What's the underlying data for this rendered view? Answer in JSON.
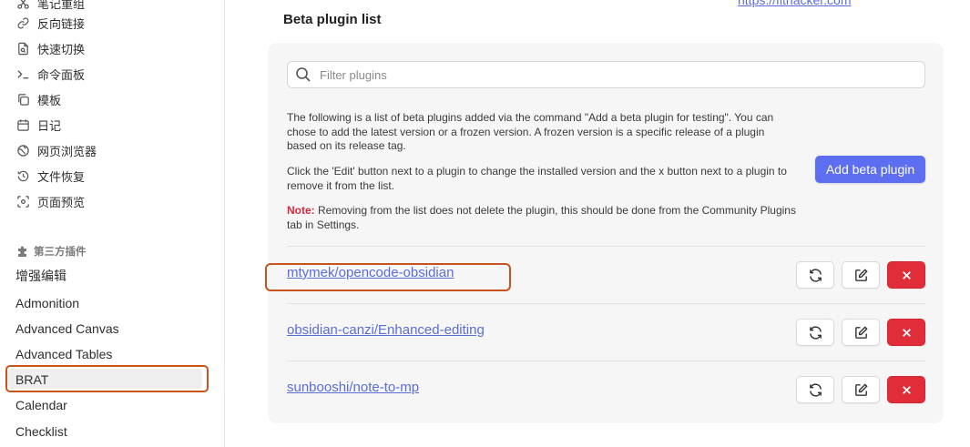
{
  "sidebar": {
    "core_items": [
      {
        "label": "笔记重组",
        "icon": "scissors-icon"
      },
      {
        "label": "反向链接",
        "icon": "link-icon"
      },
      {
        "label": "快速切换",
        "icon": "file-search-icon"
      },
      {
        "label": "命令面板",
        "icon": "terminal-icon"
      },
      {
        "label": "模板",
        "icon": "copy-icon"
      },
      {
        "label": "日记",
        "icon": "calendar-icon"
      },
      {
        "label": "网页浏览器",
        "icon": "globe-icon"
      },
      {
        "label": "文件恢复",
        "icon": "history-icon"
      },
      {
        "label": "页面预览",
        "icon": "preview-icon"
      }
    ],
    "community_header": "第三方插件",
    "community_icon": "puzzle-icon",
    "plugins": [
      {
        "label": "增强编辑"
      },
      {
        "label": "Admonition"
      },
      {
        "label": "Advanced Canvas"
      },
      {
        "label": "Advanced Tables"
      },
      {
        "label": "BRAT",
        "selected": true
      },
      {
        "label": "Calendar"
      },
      {
        "label": "Checklist"
      }
    ]
  },
  "main": {
    "url_peek": "https://fithacker.com",
    "section_title": "Beta plugin list",
    "search": {
      "placeholder": "Filter plugins",
      "value": ""
    },
    "description_1": "The following is a list of beta plugins added via the command \"Add a beta plugin for testing\". You can chose to add the latest version or a frozen version. A frozen version is a specific release of a plugin based on its release tag.",
    "description_2": "Click the 'Edit' button next to a plugin to change the installed version and the x button next to a plugin to remove it from the list.",
    "note_label": "Note:",
    "note_text": " Removing from the list does not delete the plugin, this should be done from the Community Plugins tab in Settings.",
    "add_button": "Add beta plugin",
    "plugins": [
      {
        "name": "mtymek/opencode-obsidian",
        "highlighted": true
      },
      {
        "name": "obsidian-canzi/Enhanced-editing"
      },
      {
        "name": "sunbooshi/note-to-mp"
      }
    ]
  },
  "colors": {
    "accent": "#5e6ef0",
    "link": "#5b6dd9",
    "danger": "#e12d3a",
    "highlight_outline": "#c8531f"
  }
}
